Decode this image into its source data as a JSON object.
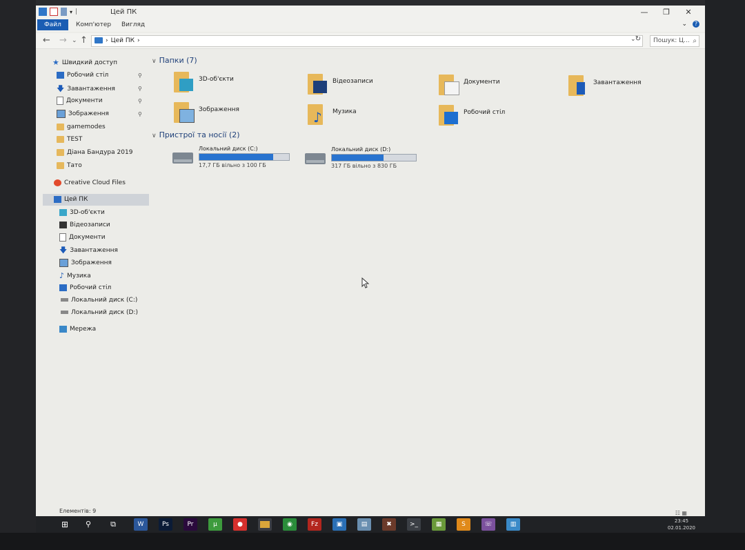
{
  "titlebar": {
    "title": "Цей ПК",
    "sep": "|",
    "min": "—",
    "max": "❐",
    "close": "✕"
  },
  "ribbon": {
    "tabs": [
      "Файл",
      "Комп'ютер",
      "Вигляд"
    ],
    "expand": "⌄",
    "help": "?"
  },
  "address": {
    "back": "←",
    "forward": "→",
    "recent": "⌄",
    "up": "↑",
    "path": "Цей ПК",
    "chevron": "›",
    "dropdown": "⌄",
    "refresh": "↻",
    "search_placeholder": "Пошук: Ц...",
    "search_icon": "⌕"
  },
  "navpane": {
    "quick_access": "Швидкий доступ",
    "quick_items": [
      {
        "label": "Робочий стіл",
        "pinned": true
      },
      {
        "label": "Завантаження",
        "pinned": true
      },
      {
        "label": "Документи",
        "pinned": true
      },
      {
        "label": "Зображення",
        "pinned": true
      },
      {
        "label": "gamemodes",
        "pinned": false
      },
      {
        "label": "TEST",
        "pinned": false
      },
      {
        "label": "Діана Бандура 2019",
        "pinned": false
      },
      {
        "label": "Тато",
        "pinned": false
      }
    ],
    "creative_cloud": "Creative Cloud Files",
    "this_pc": "Цей ПК",
    "pc_items": [
      "3D-об'єкти",
      "Відеозаписи",
      "Документи",
      "Завантаження",
      "Зображення",
      "Музика",
      "Робочий стіл",
      "Локальний диск (C:)",
      "Локальний диск (D:)"
    ],
    "network": "Мережа",
    "pin_glyph": "📌"
  },
  "content": {
    "folders_header": "Папки (7)",
    "folders": [
      {
        "label": "3D-об'єкти",
        "icon": "3d-objects-icon",
        "badge": "#2f9ec4"
      },
      {
        "label": "Відеозаписи",
        "icon": "videos-icon",
        "badge": "#1d3f7a"
      },
      {
        "label": "Документи",
        "icon": "documents-icon",
        "badge": "#f4f4f4"
      },
      {
        "label": "Завантаження",
        "icon": "downloads-icon",
        "badge": "#1d5bb8"
      },
      {
        "label": "Зображення",
        "icon": "pictures-icon",
        "badge": "#7fb2e0"
      },
      {
        "label": "Музика",
        "icon": "music-icon",
        "badge": "#1d5bb8"
      },
      {
        "label": "Робочий стіл",
        "icon": "desktop-icon",
        "badge": "#1e6fd0"
      }
    ],
    "devices_header": "Пристрої та носії (2)",
    "drives": [
      {
        "name": "Локальний диск (C:)",
        "free": "17,7 ГБ вільно з 100 ГБ",
        "used_fraction": 0.823
      },
      {
        "name": "Локальний диск (D:)",
        "free": "317 ГБ вільно з 830 ГБ",
        "used_fraction": 0.618
      }
    ]
  },
  "status": {
    "items": "Елементів: 9",
    "view_icons": "☷ ▦"
  },
  "taskbar": {
    "start": "⊞",
    "search": "⚲",
    "taskview": "⧉",
    "apps": [
      {
        "label": "W",
        "color": "#2b579a"
      },
      {
        "label": "Ps",
        "color": "#0b1b36"
      },
      {
        "label": "Pr",
        "color": "#2a0a3c"
      },
      {
        "label": "µ",
        "color": "#3d9b3d"
      },
      {
        "label": "●",
        "color": "#d6302d"
      },
      {
        "label": "▭",
        "color": "#d9a53a"
      },
      {
        "label": "◉",
        "color": "#2a8c3a"
      },
      {
        "label": "Fz",
        "color": "#b3261e"
      },
      {
        "label": "▣",
        "color": "#2a6fb5"
      },
      {
        "label": "▤",
        "color": "#6a8fb0"
      },
      {
        "label": "✖",
        "color": "#6b3a2a"
      },
      {
        "label": ">_",
        "color": "#3b3f45"
      },
      {
        "label": "▦",
        "color": "#6a9a3a"
      },
      {
        "label": "S",
        "color": "#e08a1a"
      },
      {
        "label": "☏",
        "color": "#7b519d"
      },
      {
        "label": "▥",
        "color": "#3a8ac8"
      }
    ],
    "time": "23:45",
    "date": "02.01.2020"
  }
}
